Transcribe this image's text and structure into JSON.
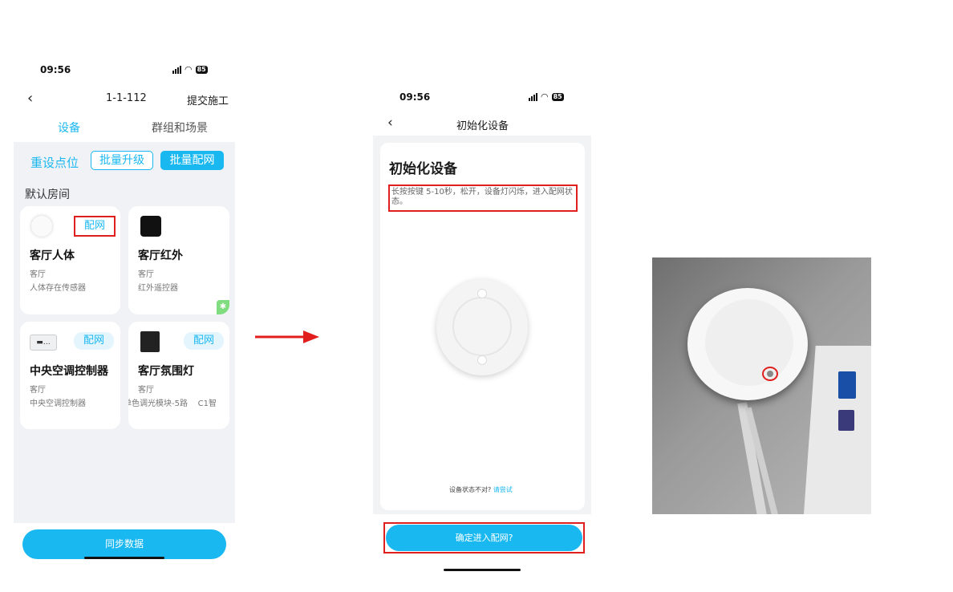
{
  "left_phone": {
    "status": {
      "time": "09:56",
      "battery": "85"
    },
    "header": {
      "title": "1-1-112",
      "submit_label": "提交施工"
    },
    "tabs": [
      {
        "label": "设备"
      },
      {
        "label": "群组和场景"
      }
    ],
    "actions": {
      "reset": "重设点位",
      "batch_upgrade": "批量升级",
      "batch_pair": "批量配网"
    },
    "room_label": "默认房间",
    "devices": [
      {
        "name": "客厅人体",
        "room": "客厅",
        "type": "人体存在传感器",
        "action": "配网"
      },
      {
        "name": "客厅红外",
        "room": "客厅",
        "type": "红外遥控器",
        "action": ""
      },
      {
        "name": "中央空调控制器",
        "room": "客厅",
        "type": "中央空调控制器",
        "action": "配网"
      },
      {
        "name": "客厅氛围灯",
        "room": "客厅",
        "type": "单色调光模块-5路    C1智",
        "action": "配网"
      }
    ],
    "sync_label": "同步数据"
  },
  "middle_phone": {
    "status": {
      "time": "09:56",
      "battery": "85"
    },
    "header": {
      "title": "初始化设备"
    },
    "card": {
      "title": "初始化设备",
      "instruction": "长按按键 5-10秒，松开，设备灯闪烁，进入配网状态。",
      "hint": "设备状态不对?",
      "hint_link": "请尝试"
    },
    "confirm_label": "确定进入配网?"
  },
  "colors": {
    "accent": "#1ab8f0",
    "highlight": "#e01e1e",
    "arrow": "#e01e1e"
  }
}
